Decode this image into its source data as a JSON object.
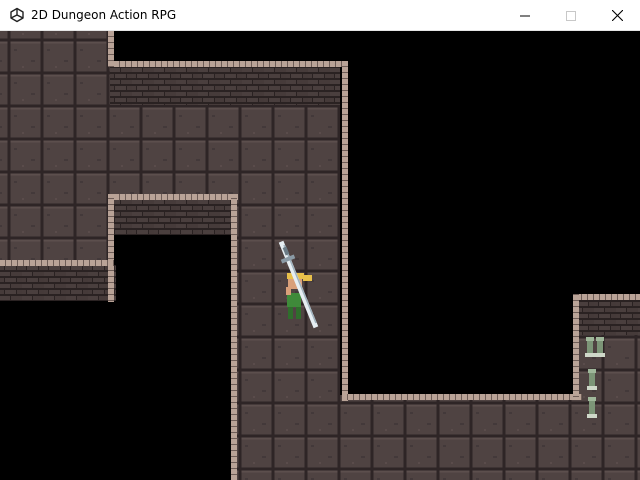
{
  "window": {
    "title": "2D Dungeon Action RPG",
    "icons": {
      "app": "unity-icon",
      "minimize": "minimize-icon",
      "maximize": "maximize-icon",
      "close": "close-icon"
    }
  },
  "colors": {
    "floor": "#4f4342",
    "floor_grout": "#2e2526",
    "floor_highlight": "#5c4f4d",
    "wall_brick": "#4a3f3e",
    "wall_mortar": "#2a2222",
    "wall_trim": "#b9a397",
    "wall_trim_dark": "#6e5d57",
    "void": "#000000",
    "player_tunic": "#3f8a3a",
    "player_hair": "#e8c04a",
    "player_skin": "#d9a07a",
    "sword_blade": "#e6eef2",
    "sword_hilt": "#8a9aa5",
    "statue": "#9fb79a"
  }
}
